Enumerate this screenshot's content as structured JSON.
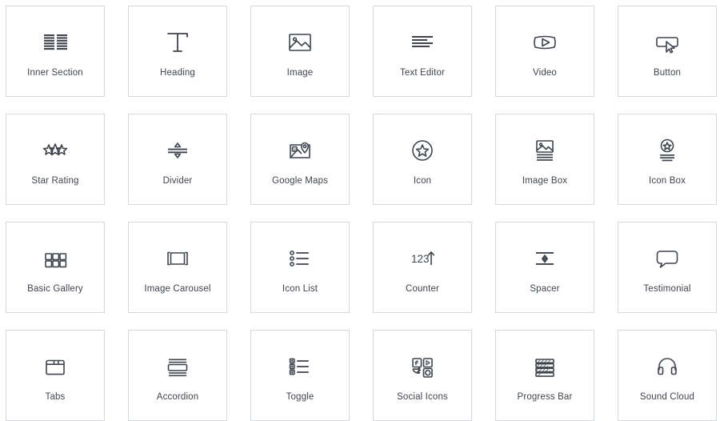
{
  "panel": {
    "name": "elementor-widget-panel",
    "accent_color": "#3f444d",
    "tile_border_color": "#d5d8dc",
    "tile_background": "#ffffff",
    "columns": 6,
    "rows": 4
  },
  "widgets": [
    {
      "label": "Inner Section",
      "icon": "inner-section-icon"
    },
    {
      "label": "Heading",
      "icon": "heading-t-icon"
    },
    {
      "label": "Image",
      "icon": "image-picture-icon"
    },
    {
      "label": "Text Editor",
      "icon": "text-lines-icon"
    },
    {
      "label": "Video",
      "icon": "video-play-icon"
    },
    {
      "label": "Button",
      "icon": "button-cursor-icon"
    },
    {
      "label": "Star Rating",
      "icon": "star-rating-icon"
    },
    {
      "label": "Divider",
      "icon": "divider-arrows-icon"
    },
    {
      "label": "Google Maps",
      "icon": "map-pin-icon"
    },
    {
      "label": "Icon",
      "icon": "star-circle-icon"
    },
    {
      "label": "Image Box",
      "icon": "image-box-icon"
    },
    {
      "label": "Icon Box",
      "icon": "icon-box-icon"
    },
    {
      "label": "Basic Gallery",
      "icon": "gallery-grid-icon"
    },
    {
      "label": "Image Carousel",
      "icon": "carousel-icon"
    },
    {
      "label": "Icon List",
      "icon": "icon-list-icon"
    },
    {
      "label": "Counter",
      "icon": "counter-123-arrow-icon"
    },
    {
      "label": "Spacer",
      "icon": "spacer-vertical-arrow-icon"
    },
    {
      "label": "Testimonial",
      "icon": "speech-bubble-icon"
    },
    {
      "label": "Tabs",
      "icon": "tabs-folder-icon"
    },
    {
      "label": "Accordion",
      "icon": "accordion-icon"
    },
    {
      "label": "Toggle",
      "icon": "toggle-plus-list-icon"
    },
    {
      "label": "Social Icons",
      "icon": "social-icons-icon"
    },
    {
      "label": "Progress Bar",
      "icon": "progress-bar-icon"
    },
    {
      "label": "Sound Cloud",
      "icon": "headphones-icon"
    }
  ],
  "counter_icon_text": "123"
}
